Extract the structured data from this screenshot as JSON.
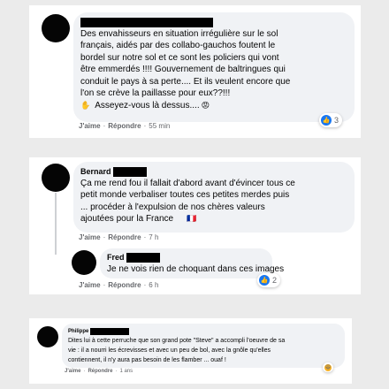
{
  "comments": [
    {
      "text": "Des envahisseurs en situation irrégulière sur le sol\nfrançais, aidés par des collabo-gauchos foutent le\nbordel sur notre sol et ce sont les policiers qui vont\nêtre emmerdés !!!! Gouvernement de baltringues qui\nconduit le pays à sa perte.... Et ils veulent encore que\nl'on se crève la paillasse pour eux??!!!",
      "last_line": "Asseyez-vous là dessus....",
      "emoji_hand": "✋",
      "emoji_face": "😡",
      "like": "J'aime",
      "reply": "Répondre",
      "time": "55 min",
      "reaction_count": "3",
      "reaction_icon": "like-icon"
    },
    {
      "name": "Bernard",
      "text": "Ça me rend fou il fallait d'abord avant d'évincer tous ce\npetit monde verbaliser toutes ces petites merdes puis\n... procéder à l'expulsion de nos chères valeurs\najoutées pour la France",
      "flag": "🇫🇷",
      "like": "J'aime",
      "reply": "Répondre",
      "time": "7 h"
    },
    {
      "name": "Fred",
      "text": "Je ne vois rien de choquant dans ces images",
      "like": "J'aime",
      "reply": "Répondre",
      "time": "6 h",
      "reaction_count": "2",
      "reaction_icon": "like-icon"
    },
    {
      "name": "Philippe",
      "text": "Dites lui à cette perruche que son grand pote \"Steve\" a accompli l'oeuvre de sa\nvie : il a nourri les écrevisses et avec un peu de bol, avec la gnôle qu'elles\ncontiennent, il n'y aura pas besoin de les flamber ... ouaf !",
      "like": "J'aime",
      "reply": "Répondre",
      "time": "1 ans",
      "reaction_icon": "haha-icon"
    }
  ]
}
